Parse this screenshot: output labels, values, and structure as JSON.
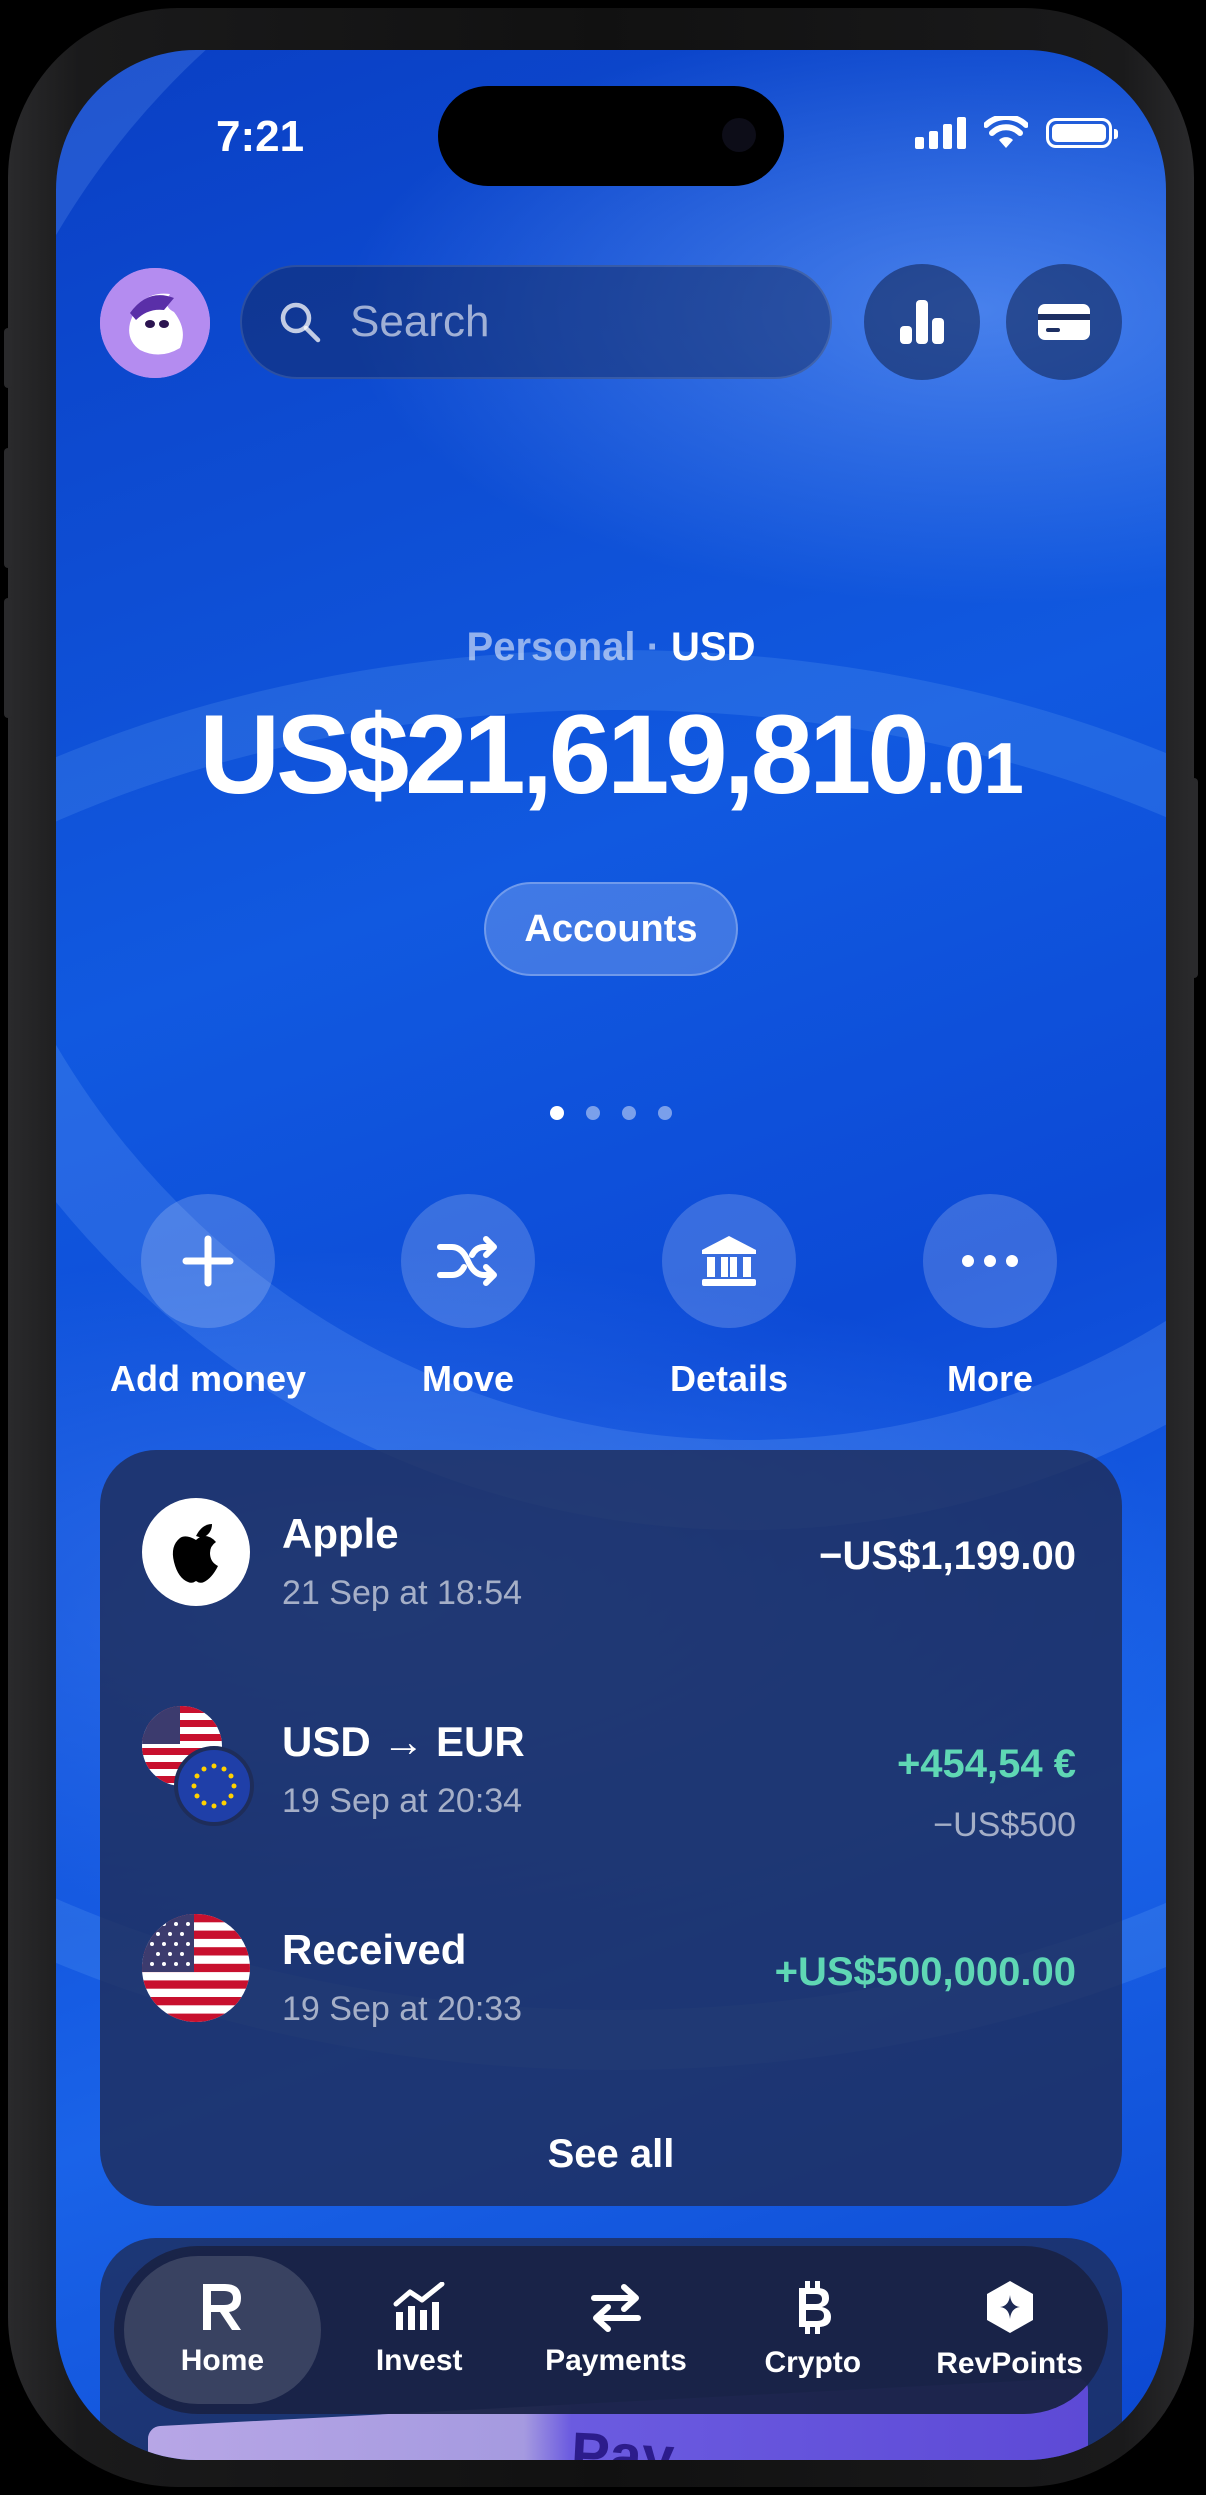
{
  "status_bar": {
    "time": "7:21"
  },
  "search": {
    "placeholder": "Search"
  },
  "balance": {
    "account_type": "Personal · ",
    "currency": "USD",
    "amount_main": "US$21,619,810",
    "amount_cents": ".01"
  },
  "accounts_button": "Accounts",
  "carousel": {
    "total_pages": 4,
    "active_page": 1
  },
  "actions": [
    {
      "label": "Add money",
      "icon": "plus-icon"
    },
    {
      "label": "Move",
      "icon": "shuffle-icon"
    },
    {
      "label": "Details",
      "icon": "bank-icon"
    },
    {
      "label": "More",
      "icon": "more-icon"
    }
  ],
  "transactions": [
    {
      "name": "Apple",
      "date": "21 Sep at 18:54",
      "amount": "−US$1,199.00",
      "amount_color": "#ffffff"
    },
    {
      "name": "USD → EUR",
      "date": "19 Sep at 20:34",
      "amount": "+454,54 €",
      "sub_amount": "−US$500",
      "amount_color": "#5fd7b4"
    },
    {
      "name": "Received",
      "date": "19 Sep at 20:33",
      "amount": "+US$500,000.00",
      "amount_color": "#5fd7b4"
    }
  ],
  "see_all": "See all",
  "tabs": [
    {
      "label": "Home",
      "icon": "revolut-r-icon",
      "active": true
    },
    {
      "label": "Invest",
      "icon": "chart-icon"
    },
    {
      "label": "Payments",
      "icon": "transfer-arrows-icon"
    },
    {
      "label": "Crypto",
      "icon": "bitcoin-icon"
    },
    {
      "label": "RevPoints",
      "icon": "revpoints-hexagon-icon"
    }
  ],
  "promo": {
    "partial_text": "Pay"
  },
  "colors": {
    "accent_blue": "#1159e0",
    "positive_green": "#5fd7b4"
  }
}
